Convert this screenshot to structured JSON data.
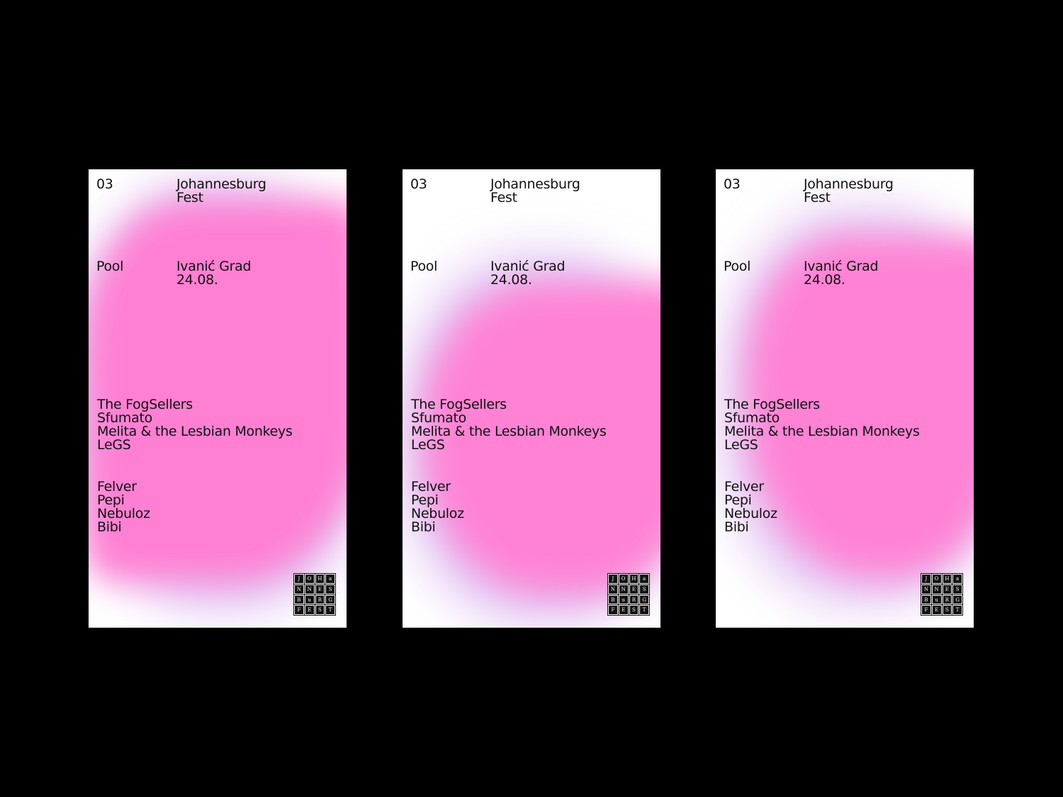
{
  "posters": [
    {
      "number": "03",
      "fest_line1": "Johannesburg",
      "fest_line2": "Fest",
      "venue_label": "Pool",
      "venue": "Ivanić Grad",
      "date": "24.08.",
      "lineup1": [
        "The FogSellers",
        "Sfumato",
        "Melita & the Lesbian Monkeys",
        "LeGS"
      ],
      "lineup2": [
        "Felver",
        "Pepi",
        "Nebuloz",
        "Bibi"
      ]
    },
    {
      "number": "03",
      "fest_line1": "Johannesburg",
      "fest_line2": "Fest",
      "venue_label": "Pool",
      "venue": "Ivanić Grad",
      "date": "24.08.",
      "lineup1": [
        "The FogSellers",
        "Sfumato",
        "Melita & the Lesbian Monkeys",
        "LeGS"
      ],
      "lineup2": [
        "Felver",
        "Pepi",
        "Nebuloz",
        "Bibi"
      ]
    },
    {
      "number": "03",
      "fest_line1": "Johannesburg",
      "fest_line2": "Fest",
      "venue_label": "Pool",
      "venue": "Ivanić Grad",
      "date": "24.08.",
      "lineup1": [
        "The FogSellers",
        "Sfumato",
        "Melita & the Lesbian Monkeys",
        "LeGS"
      ],
      "lineup2": [
        "Felver",
        "Pepi",
        "Nebuloz",
        "Bibi"
      ]
    }
  ],
  "logo_letters": [
    "J",
    "O",
    "H",
    "a",
    "N",
    "N",
    "E",
    "S",
    "B",
    "u",
    "R",
    "G",
    "F",
    "E",
    "S",
    "T"
  ],
  "colors": {
    "background": "#000000",
    "poster": "#ffffff",
    "pink": "#ff7fd2",
    "lavender_edge": "#c996eb",
    "text": "#111111"
  }
}
